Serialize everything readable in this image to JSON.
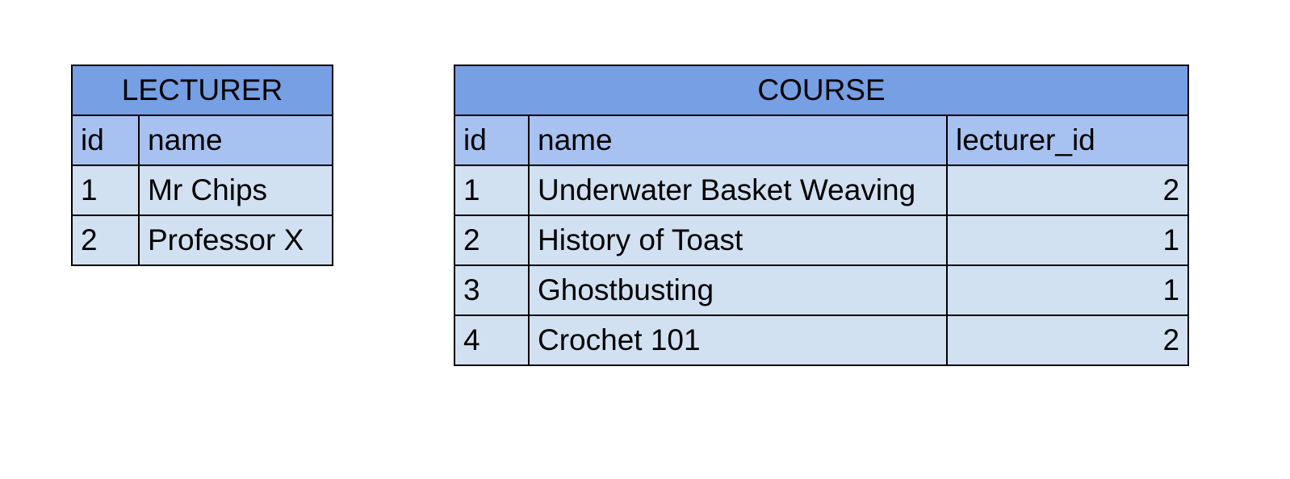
{
  "colors": {
    "title_bg": "#769fe4",
    "header_bg": "#a7c2f0",
    "cell_bg": "#d1e1f1",
    "border": "#000000"
  },
  "lecturer": {
    "title": "LECTURER",
    "columns": [
      "id",
      "name"
    ],
    "rows": [
      [
        "1",
        "Mr Chips"
      ],
      [
        "2",
        "Professor X"
      ]
    ]
  },
  "course": {
    "title": "COURSE",
    "columns": [
      "id",
      "name",
      "lecturer_id"
    ],
    "rows": [
      [
        "1",
        "Underwater Basket Weaving",
        "2"
      ],
      [
        "2",
        "History of Toast",
        "1"
      ],
      [
        "3",
        "Ghostbusting",
        "1"
      ],
      [
        "4",
        "Crochet 101",
        "2"
      ]
    ]
  }
}
